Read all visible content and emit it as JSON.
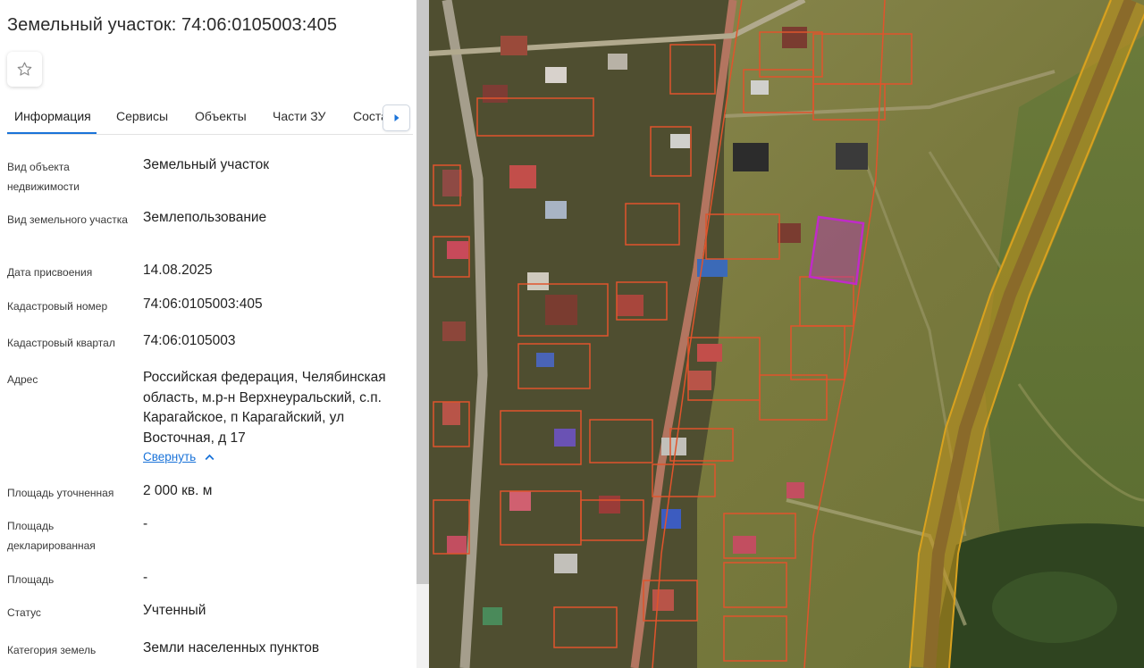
{
  "header": {
    "title": "Земельный участок: 74:06:0105003:405"
  },
  "favorite": {
    "icon": "star-icon"
  },
  "tabs": [
    {
      "label": "Информация",
      "active": true
    },
    {
      "label": "Сервисы",
      "active": false
    },
    {
      "label": "Объекты",
      "active": false
    },
    {
      "label": "Части ЗУ",
      "active": false
    },
    {
      "label": "Соста",
      "active": false
    }
  ],
  "tabs_next_icon": "chevron-right-icon",
  "details": {
    "object_type": {
      "label": "Вид объекта недвижимости",
      "value": "Земельный участок"
    },
    "plot_type": {
      "label": "Вид земельного участка",
      "value": "Землепользование"
    },
    "assign_date": {
      "label": "Дата присвоения",
      "value": "14.08.2025"
    },
    "cadastral_number": {
      "label": "Кадастровый номер",
      "value": "74:06:0105003:405"
    },
    "cadastral_quarter": {
      "label": "Кадастровый квартал",
      "value": "74:06:0105003"
    },
    "address": {
      "label": "Адрес",
      "value": "Российская федерация, Челябинская область, м.р-н Верхнеуральский, с.п. Карагайское, п Карагайский, ул Восточная, д 17"
    },
    "collapse_label": "Свернуть",
    "area_specified": {
      "label": "Площадь уточненная",
      "value": "2 000 кв. м"
    },
    "area_declared": {
      "label": "Площадь декларированная",
      "value": "-"
    },
    "area": {
      "label": "Площадь",
      "value": "-"
    },
    "status": {
      "label": "Статус",
      "value": "Учтенный"
    },
    "land_category": {
      "label": "Категория земель",
      "value": "Земли населенных пунктов"
    }
  },
  "colors": {
    "accent": "#1a73d9",
    "parcel_outline": "#e0542c",
    "selected_parcel": "#c02bc8",
    "zone_outline": "#d9a21f"
  }
}
